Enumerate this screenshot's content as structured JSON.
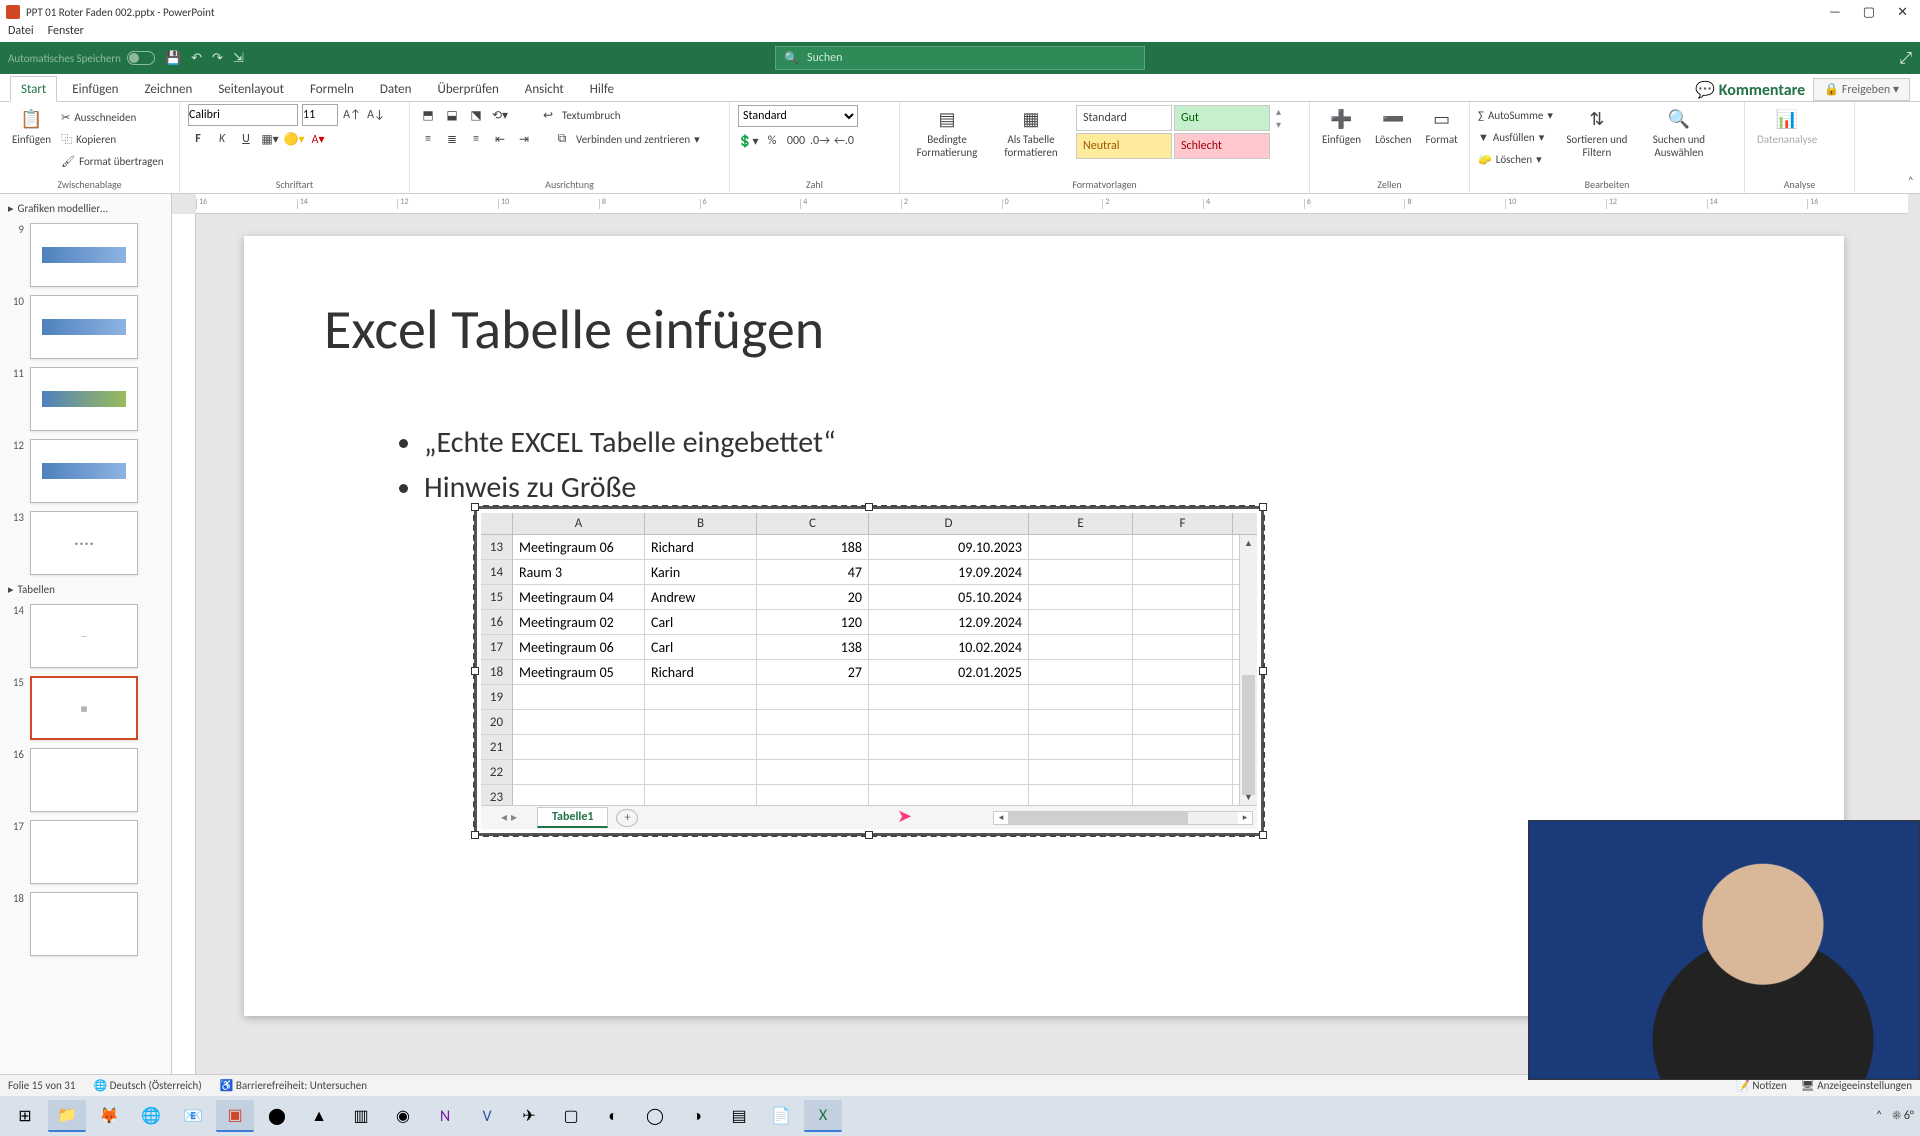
{
  "title": "PPT 01 Roter Faden 002.pptx - PowerPoint",
  "menu": [
    "Datei",
    "Fenster"
  ],
  "qat": {
    "autosave": "Automatisches Speichern",
    "search_placeholder": "Suchen"
  },
  "tabs": [
    "Start",
    "Einfügen",
    "Zeichnen",
    "Seitenlayout",
    "Formeln",
    "Daten",
    "Überprüfen",
    "Ansicht",
    "Hilfe"
  ],
  "right_buttons": {
    "comments": "Kommentare",
    "share": "Freigeben"
  },
  "ribbon": {
    "clipboard": {
      "paste": "Einfügen",
      "cut": "Ausschneiden",
      "copy": "Kopieren",
      "formatpainter": "Format übertragen",
      "label": "Zwischenablage"
    },
    "font": {
      "name": "Calibri",
      "size": "11",
      "label": "Schriftart"
    },
    "align": {
      "wrap": "Textumbruch",
      "merge": "Verbinden und zentrieren",
      "label": "Ausrichtung"
    },
    "number": {
      "format": "Standard",
      "label": "Zahl"
    },
    "styles": {
      "cond": "Bedingte Formatierung",
      "astable": "Als Tabelle formatieren",
      "standard": "Standard",
      "gut": "Gut",
      "neutral": "Neutral",
      "schlecht": "Schlecht",
      "label": "Formatvorlagen"
    },
    "cells": {
      "insert": "Einfügen",
      "delete": "Löschen",
      "format": "Format",
      "label": "Zellen"
    },
    "editing": {
      "autosum": "AutoSumme",
      "fill": "Ausfüllen",
      "clear": "Löschen",
      "sort": "Sortieren und Filtern",
      "find": "Suchen und Auswählen",
      "label": "Bearbeiten"
    },
    "analysis": {
      "data": "Datenanalyse",
      "label": "Analyse"
    }
  },
  "thumbs": {
    "section1": "Grafiken modellier…",
    "section2": "Tabellen",
    "nums": [
      "9",
      "10",
      "11",
      "12",
      "13",
      "14",
      "15",
      "16",
      "17",
      "18"
    ]
  },
  "slide": {
    "title": "Excel Tabelle einfügen",
    "b1": "„Echte EXCEL Tabelle eingebettet“",
    "b2": "Hinweis zu Größe"
  },
  "excel": {
    "cols": [
      "A",
      "B",
      "C",
      "D",
      "E",
      "F"
    ],
    "rownums": [
      "13",
      "14",
      "15",
      "16",
      "17",
      "18",
      "19",
      "20",
      "21",
      "22",
      "23"
    ],
    "rows": [
      {
        "a": "Meetingraum 06",
        "b": "Richard",
        "c": "188",
        "d": "09.10.2023"
      },
      {
        "a": "Raum 3",
        "b": "Karin",
        "c": "47",
        "d": "19.09.2024"
      },
      {
        "a": "Meetingraum 04",
        "b": "Andrew",
        "c": "20",
        "d": "05.10.2024"
      },
      {
        "a": "Meetingraum 02",
        "b": "Carl",
        "c": "120",
        "d": "12.09.2024"
      },
      {
        "a": "Meetingraum 06",
        "b": "Carl",
        "c": "138",
        "d": "10.02.2024"
      },
      {
        "a": "Meetingraum 05",
        "b": "Richard",
        "c": "27",
        "d": "02.01.2025"
      }
    ],
    "sheet": "Tabelle1"
  },
  "status": {
    "slide": "Folie 15 von 31",
    "lang": "Deutsch (Österreich)",
    "access": "Barrierefreiheit: Untersuchen",
    "notes": "Notizen",
    "display": "Anzeigeeinstellungen"
  },
  "tray": {
    "temp": "6°"
  }
}
